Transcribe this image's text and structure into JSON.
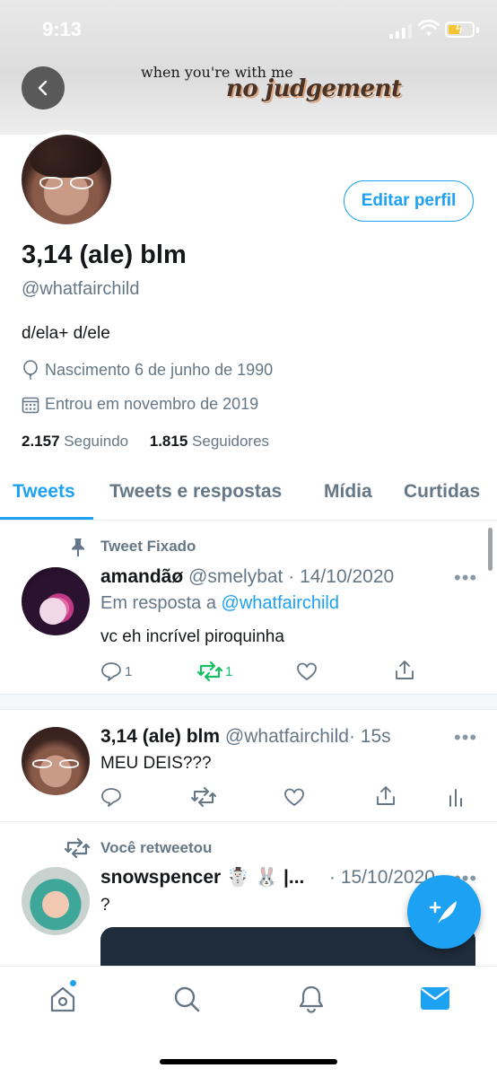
{
  "status_bar": {
    "time": "9:13"
  },
  "header": {
    "banner_line1": "when you're with me",
    "banner_line2": "no judgement",
    "back_icon": "chevron-left-icon"
  },
  "profile": {
    "display_name": "3,14 (ale) blm",
    "handle": "@whatfairchild",
    "bio": "d/ela+ d/ele",
    "birthday": "Nascimento 6 de junho de 1990",
    "joined": "Entrou em novembro de 2019",
    "following_count": "2.157",
    "following_label": "Seguindo",
    "followers_count": "1.815",
    "followers_label": "Seguidores",
    "edit_label": "Editar perfil"
  },
  "tabs": [
    {
      "label": "Tweets",
      "active": true
    },
    {
      "label": "Tweets e respostas",
      "active": false
    },
    {
      "label": "Mídia",
      "active": false
    },
    {
      "label": "Curtidas",
      "active": false
    }
  ],
  "tweets": [
    {
      "context": "Tweet Fixado",
      "context_icon": "pin-icon",
      "name": "amandãø",
      "handle": "@smelybat",
      "time": "· 14/10/2020",
      "reply_prefix": "Em resposta a",
      "reply_handle": "@whatfairchild",
      "text": "vc eh incrível piroquinha",
      "replies": "1",
      "retweets": "1",
      "likes": "",
      "more": "•••"
    },
    {
      "name": "3,14 (ale) blm",
      "handle": "@whatfairchild",
      "time": "· 15s",
      "text": "MEU DEIS???",
      "more": "•••"
    },
    {
      "context": "Você retweetou",
      "context_icon": "retweet-icon",
      "name": "snowspencer ☃️ 🐰 |...",
      "handle": "",
      "time": "· 15/10/2020",
      "text": "?",
      "more": "•••"
    }
  ],
  "compose_icon": "compose-tweet-icon",
  "nav": [
    "home-icon",
    "search-icon",
    "notifications-icon",
    "messages-icon"
  ],
  "colors": {
    "accent": "#1da1f2",
    "secondary_text": "#657786",
    "retweeted": "#17bf63"
  }
}
